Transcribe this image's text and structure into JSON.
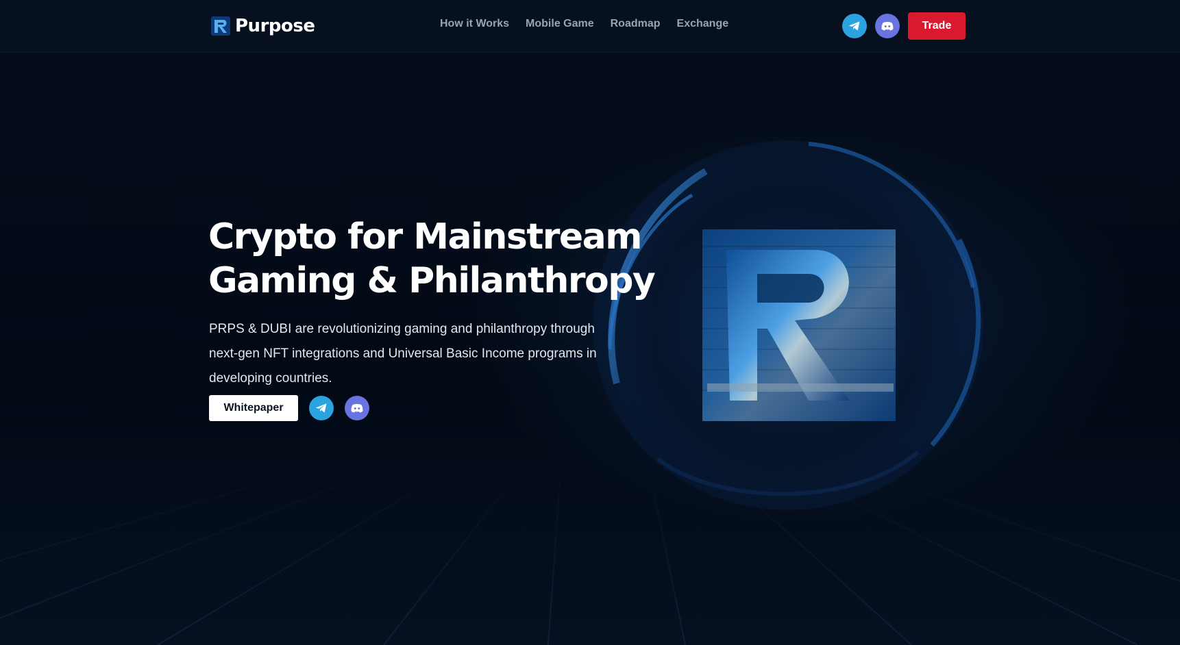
{
  "nav": {
    "brand": "Purpose",
    "links": [
      "How it Works",
      "Mobile Game",
      "Roadmap",
      "Exchange"
    ],
    "trade_label": "Trade"
  },
  "hero": {
    "title_line1": "Crypto for Mainstream",
    "title_line2": "Gaming & Philanthropy",
    "description": "PRPS & DUBI are revolutionizing gaming and philanthropy through next-gen NFT integrations and Universal Basic Income programs in developing countries.",
    "whitepaper_label": "Whitepaper"
  },
  "icons": {
    "telegram": "telegram-icon",
    "discord": "discord-icon",
    "logo": "purpose-logo-icon"
  },
  "colors": {
    "background": "#040b17",
    "trade": "#d9192e",
    "telegram": "#2aa3de",
    "discord": "#6a74e0",
    "nav_text": "#9aa3b2"
  }
}
